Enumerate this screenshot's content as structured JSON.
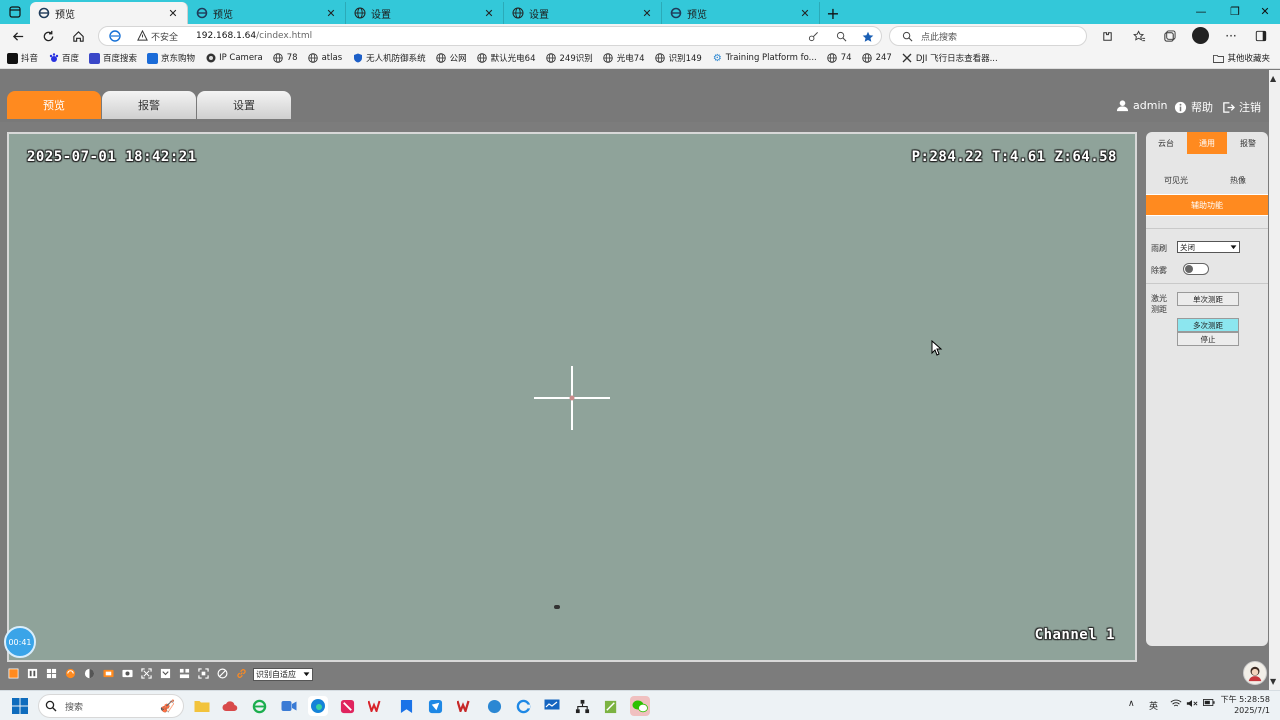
{
  "browser": {
    "tabs": [
      {
        "label": "预览",
        "active": true
      },
      {
        "label": "预览",
        "active": false
      },
      {
        "label": "设置",
        "active": false
      },
      {
        "label": "设置",
        "active": false
      },
      {
        "label": "预览",
        "active": false
      }
    ],
    "insecure_label": "不安全",
    "url_host": "192.168.1.64",
    "url_path": "/cindex.html",
    "search_placeholder": "点此搜索",
    "accent_color": "#33c8d9"
  },
  "bookmarks": [
    {
      "label": "抖音",
      "icon": "tiktok-icon"
    },
    {
      "label": "百度",
      "icon": "baidu-icon"
    },
    {
      "label": "百度搜索",
      "icon": "baidu-search-icon"
    },
    {
      "label": "京东购物",
      "icon": "jd-icon"
    },
    {
      "label": "IP Camera",
      "icon": "camera-icon"
    },
    {
      "label": "78",
      "icon": "globe-icon"
    },
    {
      "label": "atlas",
      "icon": "globe-icon"
    },
    {
      "label": "无人机防御系统",
      "icon": "shield-icon"
    },
    {
      "label": "公网",
      "icon": "globe-icon"
    },
    {
      "label": "默认光电64",
      "icon": "globe-icon"
    },
    {
      "label": "249识别",
      "icon": "globe-icon"
    },
    {
      "label": "光电74",
      "icon": "globe-icon"
    },
    {
      "label": "识别149",
      "icon": "globe-icon"
    },
    {
      "label": "Training Platform fo...",
      "icon": "gear-icon"
    },
    {
      "label": "74",
      "icon": "globe-icon"
    },
    {
      "label": "247",
      "icon": "globe-icon"
    },
    {
      "label": "DJI 飞行日志查看器...",
      "icon": "dji-icon"
    }
  ],
  "bookmarks_other": "其他收藏夹",
  "app": {
    "nav_tabs": [
      {
        "label": "预览",
        "active": true
      },
      {
        "label": "报警",
        "active": false
      },
      {
        "label": "设置",
        "active": false
      }
    ],
    "user": "admin",
    "help": "帮助",
    "logout": "注销",
    "accent_color": "#ff8a1f"
  },
  "video": {
    "timestamp": "2025-07-01 18:42:21",
    "ptz": "P:284.22 T:4.61 Z:64.58",
    "channel": "Channel 1",
    "timer": "00:41"
  },
  "panel": {
    "tabs": [
      {
        "label": "云台",
        "active": false
      },
      {
        "label": "通用",
        "active": true
      },
      {
        "label": "报警",
        "active": false
      }
    ],
    "sub_visible": "可见光",
    "sub_thermal": "热像",
    "assist": "辅助功能",
    "wiper_label": "雨刷",
    "wiper_value": "关闭",
    "defog_label": "除雾",
    "laser_label_1": "激光",
    "laser_label_2": "测距",
    "single_range": "单次测距",
    "multi_range": "多次测距",
    "stop": "停止"
  },
  "video_toolbar": {
    "fit_mode": "识别自适应"
  },
  "taskbar": {
    "search": "搜索",
    "ime": "英",
    "time": "下午 5:28:58",
    "date": "2025/7/1"
  }
}
